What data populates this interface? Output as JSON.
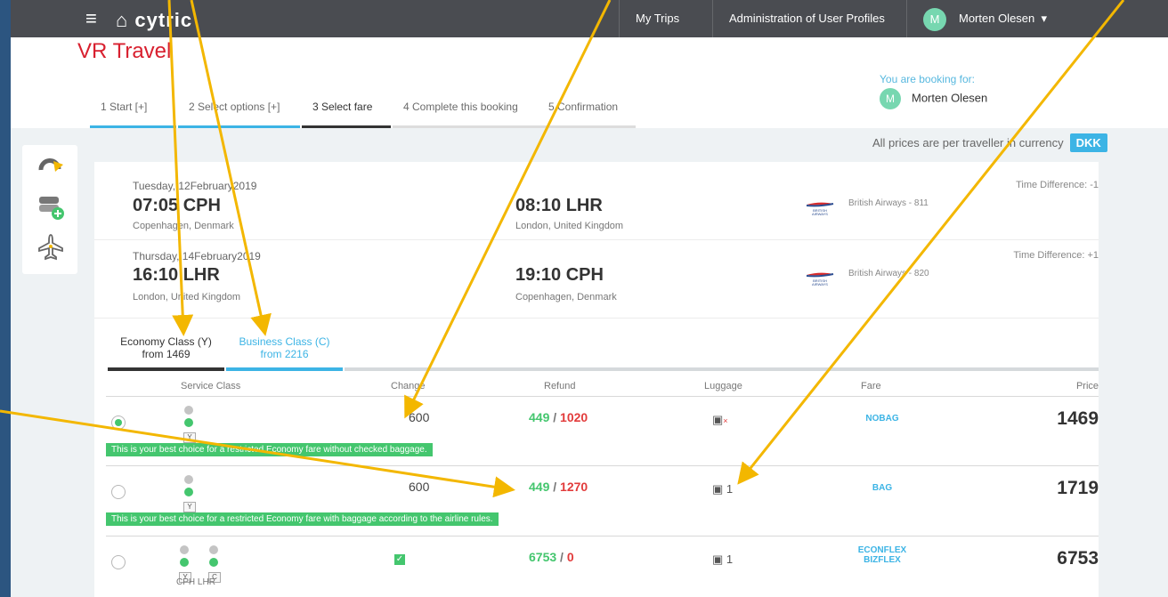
{
  "topbar": {
    "menu_icon": "hamburger-icon",
    "logo": "cytric",
    "nav": [
      "My Trips",
      "Administration of User Profiles"
    ],
    "user": "Morten Olesen",
    "user_initial": "M"
  },
  "header": {
    "brand": "VR Travel",
    "steps": [
      "1 Start  [+]",
      "2 Select options  [+]",
      "3 Select fare",
      "4 Complete this booking",
      "5 Confirmation"
    ],
    "booking_for_label": "You are booking for:",
    "booking_for_name": "Morten Olesen",
    "booking_for_initial": "M"
  },
  "currency_note": "All prices are per traveller in currency",
  "currency": "DKK",
  "flights": [
    {
      "date": "Tuesday, 12February2019",
      "dep_time": "07:05 CPH",
      "dep_city": "Copenhagen, Denmark",
      "arr_time": "08:10 LHR",
      "arr_city": "London, United Kingdom",
      "airline": "British Airways - 811",
      "time_diff": "Time Difference: -1"
    },
    {
      "date": "Thursday, 14February2019",
      "dep_time": "16:10 LHR",
      "dep_city": "London, United Kingdom",
      "arr_time": "19:10 CPH",
      "arr_city": "Copenhagen, Denmark",
      "airline": "British Airways - 820",
      "time_diff": "Time Difference: +1"
    }
  ],
  "class_tabs": [
    {
      "label": "Economy Class (Y)",
      "from": "from 1469"
    },
    {
      "label": "Business Class (C)",
      "from": "from 2216"
    }
  ],
  "table": {
    "headers": [
      "Service Class",
      "Change",
      "Refund",
      "Luggage",
      "Fare",
      "Price"
    ],
    "rows": [
      {
        "selected": true,
        "codes": [
          "Y"
        ],
        "change": "600",
        "refund_green": "449",
        "refund_red": "1020",
        "luggage": "",
        "fare": "NOBAG",
        "price": "1469",
        "hint": "This is your best choice for a restricted Economy fare without checked baggage."
      },
      {
        "selected": false,
        "codes": [
          "Y"
        ],
        "change": "600",
        "refund_green": "449",
        "refund_red": "1270",
        "luggage": "1",
        "fare": "BAG",
        "price": "1719",
        "hint": "This is your best choice for a restricted Economy fare with baggage according to the airline rules."
      },
      {
        "selected": false,
        "codes": [
          "Y",
          "C"
        ],
        "code_labels": [
          "CPH",
          "LHR"
        ],
        "change": "",
        "refund_green": "6753",
        "refund_red": "0",
        "luggage": "1",
        "fare": "ECONFLEX",
        "fare2": "BIZFLEX",
        "price": "6753"
      }
    ]
  },
  "colors": {
    "accent_blue": "#3cb4e5",
    "refund_green": "#44c66e",
    "refund_red": "#e23b3b",
    "annotation_yellow": "#f3b700"
  }
}
